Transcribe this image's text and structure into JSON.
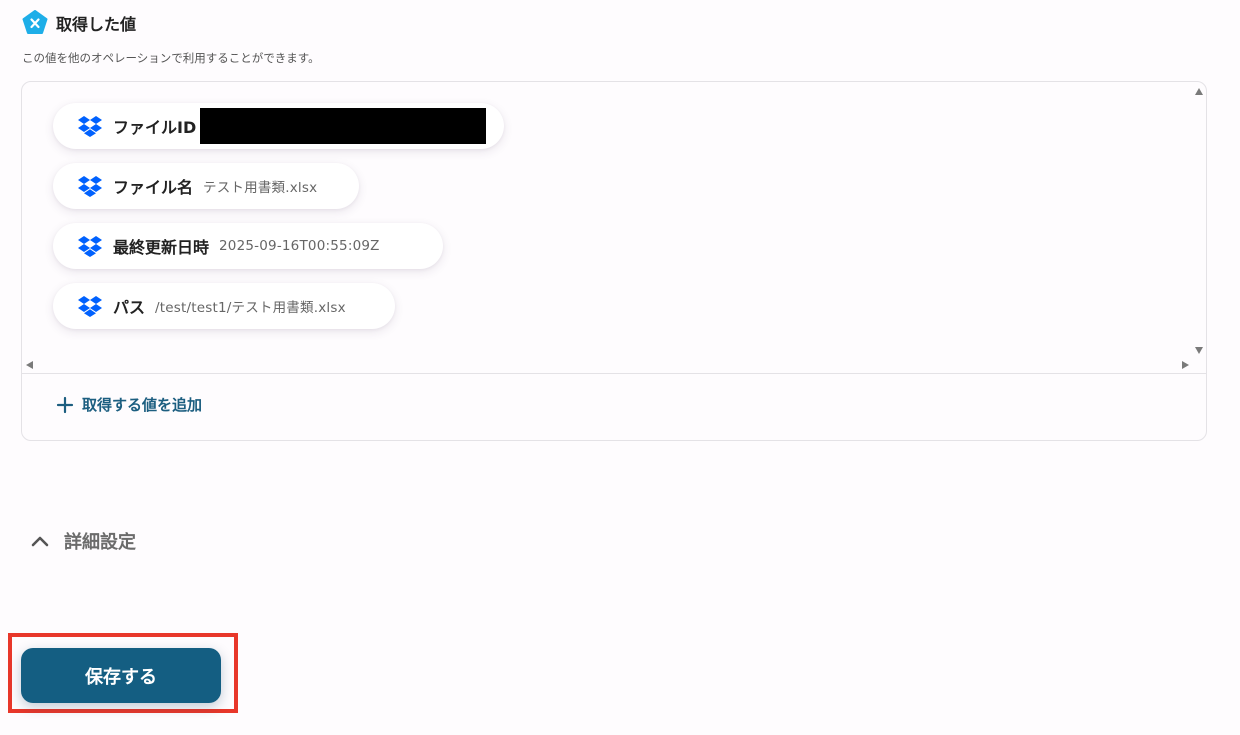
{
  "section": {
    "title": "取得した値",
    "description": "この値を他のオペレーションで利用することができます。",
    "badge_icon": "x-badge-icon"
  },
  "values": [
    {
      "label": "ファイルID",
      "value": "",
      "redacted": true,
      "icon": "dropbox-icon"
    },
    {
      "label": "ファイル名",
      "value": "テスト用書類.xlsx",
      "icon": "dropbox-icon"
    },
    {
      "label": "最終更新日時",
      "value": "2025-09-16T00:55:09Z",
      "icon": "dropbox-icon"
    },
    {
      "label": "パス",
      "value": "/test/test1/テスト用書類.xlsx",
      "icon": "dropbox-icon"
    }
  ],
  "add_value": {
    "label": "取得する値を追加",
    "icon": "plus-icon"
  },
  "advanced": {
    "label": "詳細設定",
    "icon": "chevron-up-icon",
    "expanded": true
  },
  "save_button": {
    "label": "保存する"
  },
  "colors": {
    "accent": "#145e82",
    "link": "#1c5e80",
    "badge": "#1eaee8",
    "dropbox": "#0061fe",
    "highlight": "#e8372a",
    "background": "#fefcfe"
  }
}
